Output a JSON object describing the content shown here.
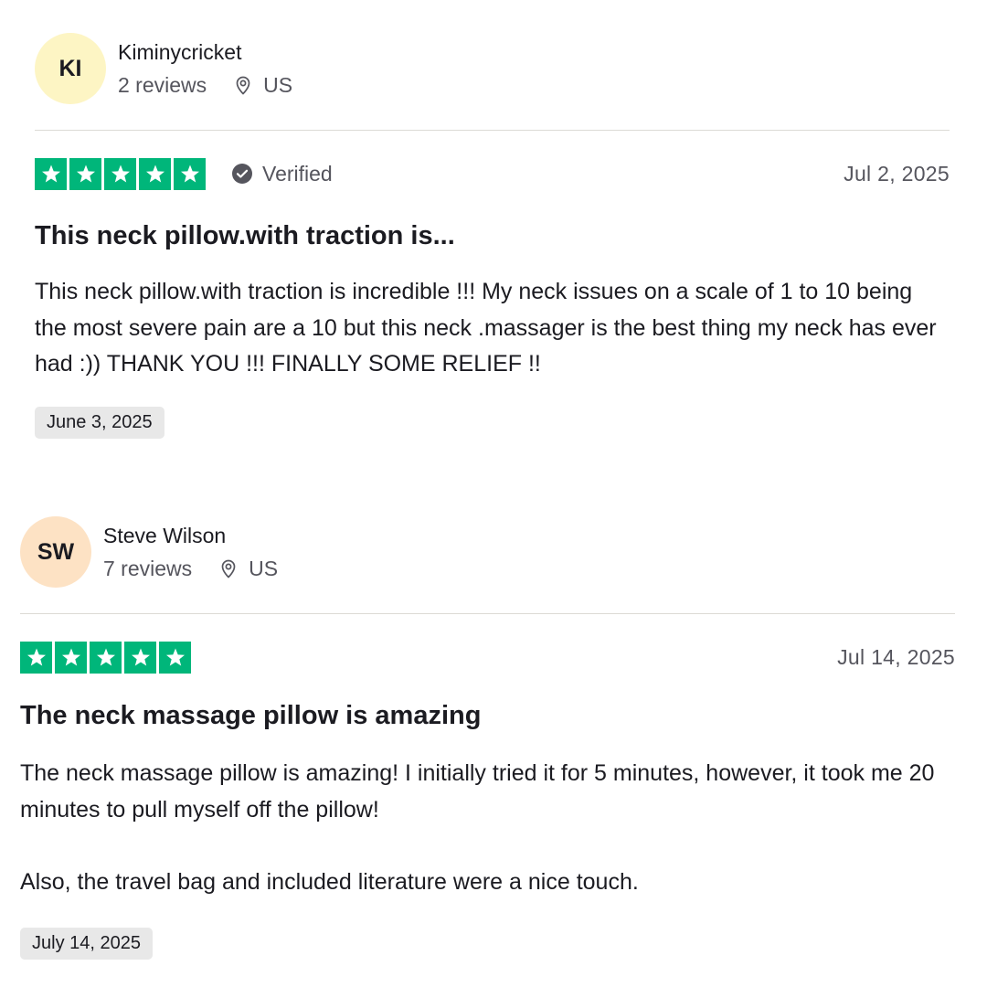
{
  "colors": {
    "star_green": "#00b67a",
    "avatar_ki": "#fdf5c4",
    "avatar_sw": "#fde2c4",
    "muted_text": "#55555d"
  },
  "reviews": [
    {
      "avatar_initials": "KI",
      "name": "Kiminycricket",
      "reviews_count": "2 reviews",
      "location": "US",
      "stars": 5,
      "verified": "Verified",
      "date": "Jul 2, 2025",
      "title": "This neck pillow.with traction is...",
      "body": [
        "This neck pillow.with traction is incredible !!! My neck issues on a scale of 1 to 10 being the most severe pain are a 10 but this neck .massager is the best thing my neck has ever had :)) THANK YOU !!! FINALLY SOME RELIEF !!"
      ],
      "experience_date": "June 3, 2025"
    },
    {
      "avatar_initials": "SW",
      "name": "Steve Wilson",
      "reviews_count": "7 reviews",
      "location": "US",
      "stars": 5,
      "date": "Jul 14, 2025",
      "title": "The neck massage pillow is amazing",
      "body": [
        "The neck massage pillow is amazing! I initially tried it for 5 minutes, however, it took me 20 minutes to pull myself off the pillow!",
        "Also, the travel bag and included literature were a nice touch."
      ],
      "experience_date": "July 14, 2025"
    }
  ]
}
